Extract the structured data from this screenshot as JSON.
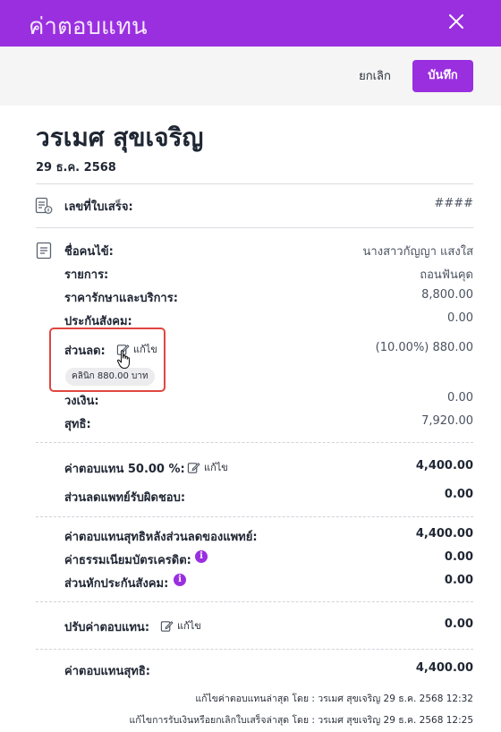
{
  "header": {
    "title": "ค่าตอบแทน",
    "close_icon": "close-icon"
  },
  "actions": {
    "cancel": "ยกเลิก",
    "save": "บันทึก"
  },
  "patient_header": {
    "name": "วรเมศ สุขเจริญ",
    "date": "29 ธ.ค. 2568"
  },
  "receipt": {
    "label": "เลขที่ใบเสร็จ:",
    "value": "####"
  },
  "details": {
    "patient_label": "ชื่อคนไข้:",
    "patient_value": "นางสาวกัญญา แสงใส",
    "item_label": "รายการ:",
    "item_value": "ถอนฟันคุด",
    "price_label": "ราคารักษาและบริการ:",
    "price_value": "8,800.00",
    "social_label": "ประกันสังคม:",
    "social_value": "0.00",
    "discount_label": "ส่วนลด:",
    "discount_value": "(10.00%) 880.00",
    "discount_edit": "แก้ไข",
    "discount_pill": "คลินิก 880.00 บาท",
    "credit_label": "วงเงิน:",
    "credit_value": "0.00",
    "net_label": "สุทธิ:",
    "net_value": "7,920.00"
  },
  "commission": {
    "rate_label": "ค่าตอบแทน 50.00 %:",
    "rate_edit": "แก้ไข",
    "rate_value": "4,400.00",
    "doctor_discount_label": "ส่วนลดแพทย์รับผิดชอบ:",
    "doctor_discount_value": "0.00",
    "after_discount_label": "ค่าตอบแทนสุทธิหลังส่วนลดของแพทย์:",
    "after_discount_value": "4,400.00",
    "card_fee_label": "ค่าธรรมเนียมบัตรเครดิต:",
    "card_fee_value": "0.00",
    "social_deduct_label": "ส่วนหักประกันสังคม:",
    "social_deduct_value": "0.00",
    "adjust_label": "ปรับค่าตอบแทน:",
    "adjust_edit": "แก้ไข",
    "adjust_value": "0.00",
    "final_label": "ค่าตอบแทนสุทธิ:",
    "final_value": "4,400.00"
  },
  "footer": {
    "line1": "แก้ไขค่าตอบแทนล่าสุด โดย : วรเมศ สุขเจริญ 29 ธ.ค. 2568 12:32",
    "line2": "แก้ไขการรับเงินหรือยกเลิกใบเสร็จล่าสุด โดย : วรเมศ สุขเจริญ 29 ธ.ค. 2568 12:25"
  },
  "colors": {
    "accent": "#9a2fe0",
    "highlight_border": "#e0463f"
  }
}
